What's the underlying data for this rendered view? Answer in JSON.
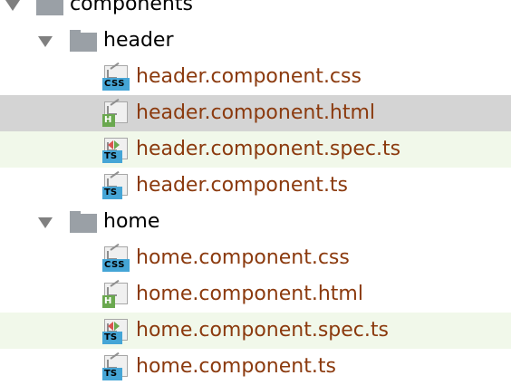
{
  "tree": {
    "root": {
      "label": "components",
      "expanded": true
    },
    "folders": [
      {
        "label": "header",
        "expanded": true,
        "files": [
          {
            "label": "header.component.css",
            "type": "css",
            "badge": "CSS"
          },
          {
            "label": "header.component.html",
            "type": "html",
            "badge": "H",
            "selected": true
          },
          {
            "label": "header.component.spec.ts",
            "type": "spec",
            "badge": "TS"
          },
          {
            "label": "header.component.ts",
            "type": "ts",
            "badge": "TS"
          }
        ]
      },
      {
        "label": "home",
        "expanded": true,
        "files": [
          {
            "label": "home.component.css",
            "type": "css",
            "badge": "CSS"
          },
          {
            "label": "home.component.html",
            "type": "html",
            "badge": "H"
          },
          {
            "label": "home.component.spec.ts",
            "type": "spec",
            "badge": "TS"
          },
          {
            "label": "home.component.ts",
            "type": "ts",
            "badge": "TS"
          }
        ]
      }
    ]
  },
  "colors": {
    "selected_row": "#d4d4d4",
    "spec_row": "#f1f8ea",
    "file_text": "#8b3a0e",
    "folder_text": "#000000",
    "css_ts_badge": "#45a5d6",
    "html_badge": "#6aa84f"
  },
  "icons": {
    "expand_arrow": "chevron-down-icon",
    "folder": "folder-icon",
    "css_file": "css-file-icon",
    "html_file": "html-file-icon",
    "ts_file": "ts-file-icon",
    "spec_file": "spec-ts-file-icon"
  }
}
